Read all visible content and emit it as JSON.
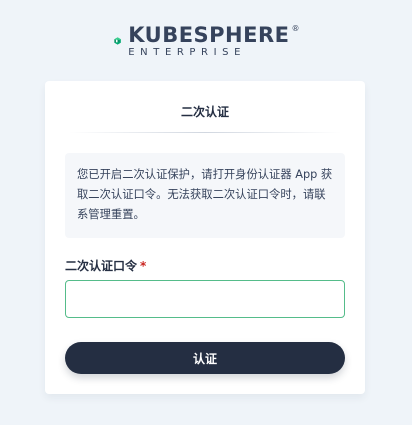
{
  "brand": {
    "name": "KUBESPHERE",
    "registered": "®",
    "edition": "ENTERPRISE",
    "logo_icon": "kubesphere-logo-icon",
    "accent_green": "#00a971",
    "accent_dark": "#36435c"
  },
  "dialog": {
    "title": "二次认证",
    "notice": "您已开启二次认证保护，请打开身份认证器 App 获取二次认证口令。无法获取二次认证口令时，请联系管理重置。",
    "field": {
      "label": "二次认证口令",
      "required_mark": "*",
      "value": "",
      "placeholder": ""
    },
    "submit_label": "认证"
  },
  "colors": {
    "page_background": "#eff4f9",
    "button_background": "#242e42",
    "input_focus_border": "#55bc8a",
    "required_mark": "#ca2621"
  }
}
